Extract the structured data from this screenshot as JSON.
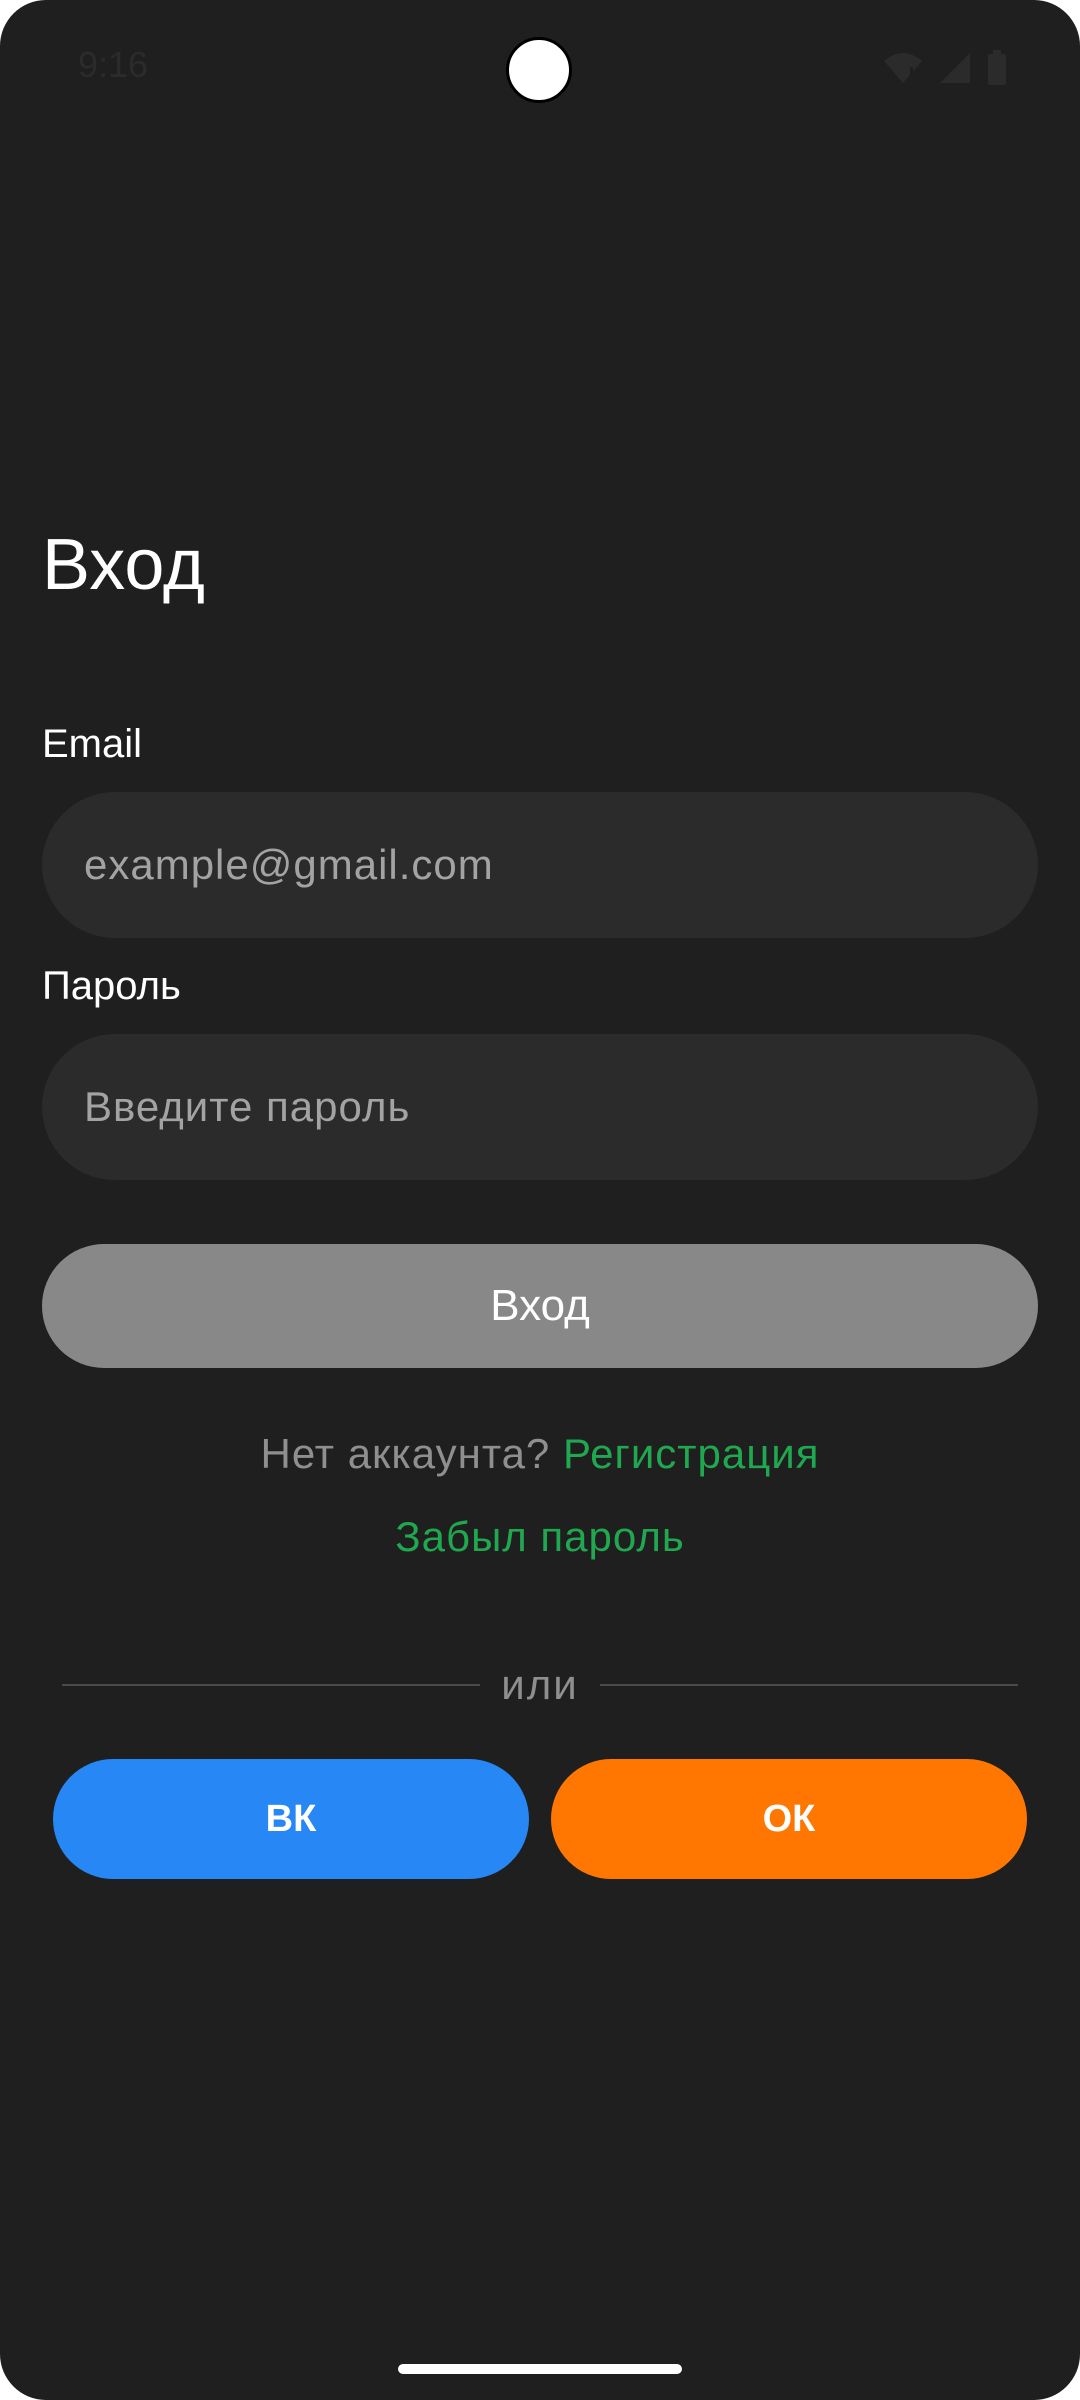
{
  "status_bar": {
    "time": "9:16",
    "icons": [
      "wifi-icon",
      "signal-icon",
      "battery-icon"
    ]
  },
  "screen": {
    "title": "Вход"
  },
  "form": {
    "email_label": "Email",
    "email_placeholder": "example@gmail.com",
    "email_value": "",
    "password_label": "Пароль",
    "password_placeholder": "Введите пароль",
    "password_value": "",
    "login_button": "Вход"
  },
  "links": {
    "no_account_text": "Нет аккаунта?",
    "register_link": "Регистрация",
    "forgot_password_link": "Забыл пароль"
  },
  "divider": {
    "text": "или"
  },
  "social": {
    "vk_label": "ВК",
    "ok_label": "ОК"
  },
  "colors": {
    "background": "#1f1f1f",
    "input_background": "#2b2b2b",
    "primary_button": "#888888",
    "link": "#1fa84f",
    "vk": "#2787f5",
    "ok": "#ff7700"
  }
}
